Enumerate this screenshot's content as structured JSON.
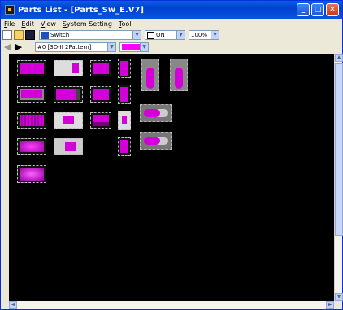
{
  "window": {
    "title": "Parts List - [Parts_Sw_E.V7]"
  },
  "menu": [
    "File",
    "Edit",
    "View",
    "System Setting",
    "Tool"
  ],
  "toolbar": {
    "part_type": "Switch",
    "state_label": "ON",
    "zoom": "100%"
  },
  "toolbar2": {
    "pattern": "#0 [3D-II 2Pattern]",
    "color": "#ff00ff"
  },
  "icons": [
    "new-icon",
    "open-icon",
    "save-icon",
    "switch-icon",
    "back-arrow-icon",
    "forward-arrow-icon"
  ],
  "scrollbar": {
    "up": "▲",
    "down": "▼",
    "left": "◄",
    "right": "►"
  }
}
